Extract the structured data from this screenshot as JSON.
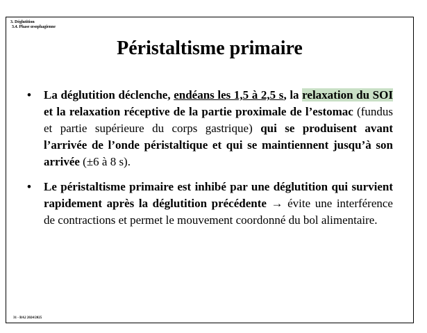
{
  "section": {
    "line1": "3. Déglutition",
    "line2": "3.4. Phase œsophagienne"
  },
  "title": "Péristaltisme primaire",
  "bullets": [
    {
      "marker": "•",
      "parts": {
        "p1": "La déglutition déclenche, ",
        "p2": "endéans les 1,5 à 2,5 s",
        "p3": ", la ",
        "p4": "relaxation du SOI",
        "p5": " et la relaxation réceptive de la partie proximale de l’estomac",
        "p6": " (fundus et  partie supérieure du corps gastrique) ",
        "p7": "qui se produisent avant l’arrivée de l’onde péristaltique et qui se maintiennent jusqu’à son arrivée",
        "p8": " (±6 à 8 s)."
      }
    },
    {
      "marker": "•",
      "parts": {
        "p1": "Le péristaltisme primaire est inhibé par une déglutition qui survient rapidement après la déglutition précédente",
        "p2": " → évite une interférence de contractions et permet le mouvement coordonné du bol alimentaire."
      }
    }
  ],
  "footer": "31 - BA2 2024/2025",
  "colors": {
    "highlight": "#c9e0c6"
  }
}
